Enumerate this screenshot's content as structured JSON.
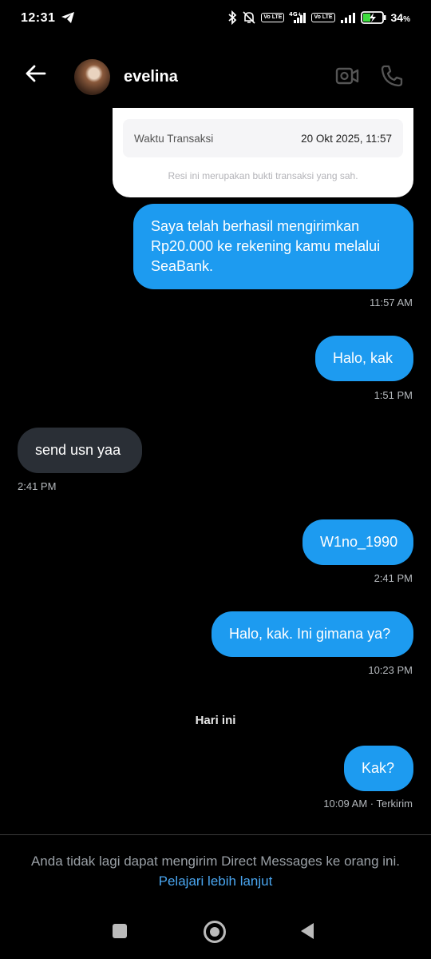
{
  "status_bar": {
    "time": "12:31",
    "battery": "34",
    "battery_unit": "%",
    "net_tag_1": "Vo LTE",
    "net_tag_2": "4G+",
    "net_tag_3": "Vo LTE"
  },
  "header": {
    "username": "evelina"
  },
  "receipt": {
    "label": "Waktu Transaksi",
    "value": "20 Okt 2025, 11:57",
    "note": "Resi ini merupakan bukti transaksi yang sah."
  },
  "messages": [
    {
      "dir": "out",
      "lines": [
        "Saya telah berhasil mengirimkan",
        "Rp20.000 ke rekening kamu melalui",
        "SeaBank."
      ],
      "time": "11:57 AM"
    },
    {
      "dir": "out",
      "text": "Halo, kak",
      "time": "1:51 PM"
    },
    {
      "dir": "in",
      "text": "send usn yaa",
      "time": "2:41 PM"
    },
    {
      "dir": "out",
      "text": "W1no_1990",
      "time": "2:41 PM"
    },
    {
      "dir": "out",
      "text": "Halo, kak. Ini gimana ya?",
      "time": "10:23 PM"
    },
    {
      "dir": "out",
      "text": "Kak?",
      "time": "10:09 AM · Terkirim"
    }
  ],
  "day_separator": "Hari ini",
  "footer": {
    "notice": "Anda tidak lagi dapat mengirim Direct Messages ke orang ini.",
    "learn_more": "Pelajari lebih lanjut"
  },
  "colors": {
    "outgoing_bubble": "#1d9bf0",
    "incoming_bubble": "#2a2f36",
    "link": "#4aa6f0"
  }
}
